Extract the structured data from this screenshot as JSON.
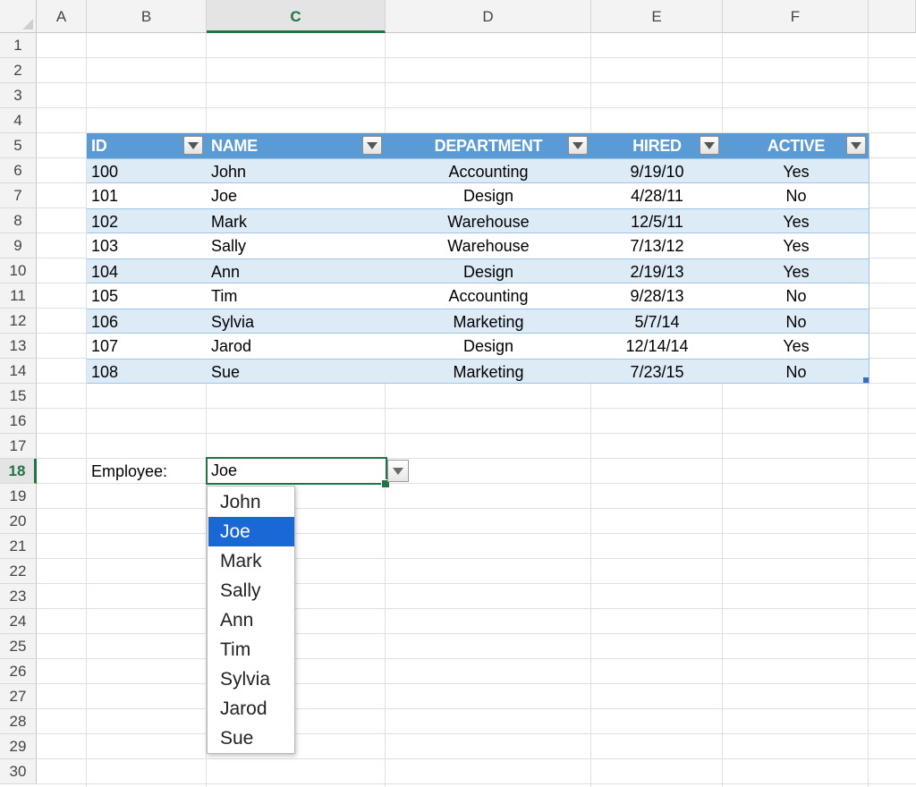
{
  "columns": [
    "A",
    "B",
    "C",
    "D",
    "E",
    "F"
  ],
  "selected_column": "C",
  "rows": [
    "1",
    "2",
    "3",
    "4",
    "5",
    "6",
    "7",
    "8",
    "9",
    "10",
    "11",
    "12",
    "13",
    "14",
    "15",
    "16",
    "17",
    "18",
    "19",
    "20",
    "21",
    "22",
    "23",
    "24",
    "25",
    "26",
    "27",
    "28",
    "29",
    "30"
  ],
  "selected_row": "18",
  "table": {
    "headers": [
      "ID",
      "NAME",
      "DEPARTMENT",
      "HIRED",
      "ACTIVE"
    ],
    "rows": [
      [
        "100",
        "John",
        "Accounting",
        "9/19/10",
        "Yes"
      ],
      [
        "101",
        "Joe",
        "Design",
        "4/28/11",
        "No"
      ],
      [
        "102",
        "Mark",
        "Warehouse",
        "12/5/11",
        "Yes"
      ],
      [
        "103",
        "Sally",
        "Warehouse",
        "7/13/12",
        "Yes"
      ],
      [
        "104",
        "Ann",
        "Design",
        "2/19/13",
        "Yes"
      ],
      [
        "105",
        "Tim",
        "Accounting",
        "9/28/13",
        "No"
      ],
      [
        "106",
        "Sylvia",
        "Marketing",
        "5/7/14",
        "No"
      ],
      [
        "107",
        "Jarod",
        "Design",
        "12/14/14",
        "Yes"
      ],
      [
        "108",
        "Sue",
        "Marketing",
        "7/23/15",
        "No"
      ]
    ]
  },
  "employee_label": "Employee:",
  "employee_value": "Joe",
  "dropdown": {
    "options": [
      "John",
      "Joe",
      "Mark",
      "Sally",
      "Ann",
      "Tim",
      "Sylvia",
      "Jarod",
      "Sue"
    ],
    "selected": "Joe"
  },
  "colors": {
    "accent": "#217346",
    "table_header": "#5b9bd5",
    "table_band": "#ddebf7",
    "dropdown_highlight": "#1a68d6"
  }
}
